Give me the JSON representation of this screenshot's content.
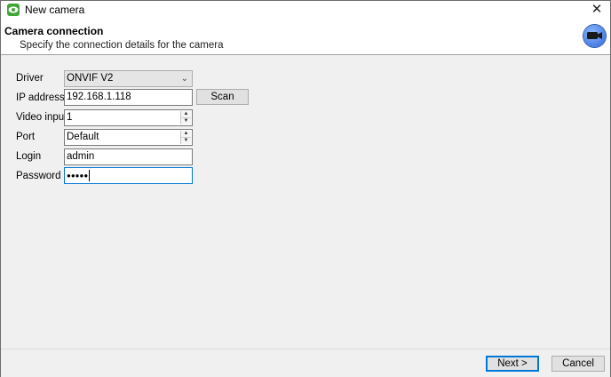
{
  "window": {
    "title": "New camera",
    "close_glyph": "✕"
  },
  "header": {
    "title": "Camera connection",
    "subtitle": "Specify the connection details for the camera",
    "icon": "webcam-icon"
  },
  "form": {
    "driver": {
      "label": "Driver",
      "value": "ONVIF V2"
    },
    "ip_address": {
      "label": "IP address",
      "value": "192.168.1.118"
    },
    "scan_button": "Scan",
    "video_input": {
      "label": "Video input",
      "value": "1"
    },
    "port": {
      "label": "Port",
      "value": "Default"
    },
    "login": {
      "label": "Login",
      "value": "admin"
    },
    "password": {
      "label": "Password",
      "value": "●●●●●"
    }
  },
  "footer": {
    "next_button": "Next >",
    "cancel_button": "Cancel"
  },
  "colors": {
    "focus_accent": "#0078d7",
    "dialog_background": "#f0f0f0"
  }
}
